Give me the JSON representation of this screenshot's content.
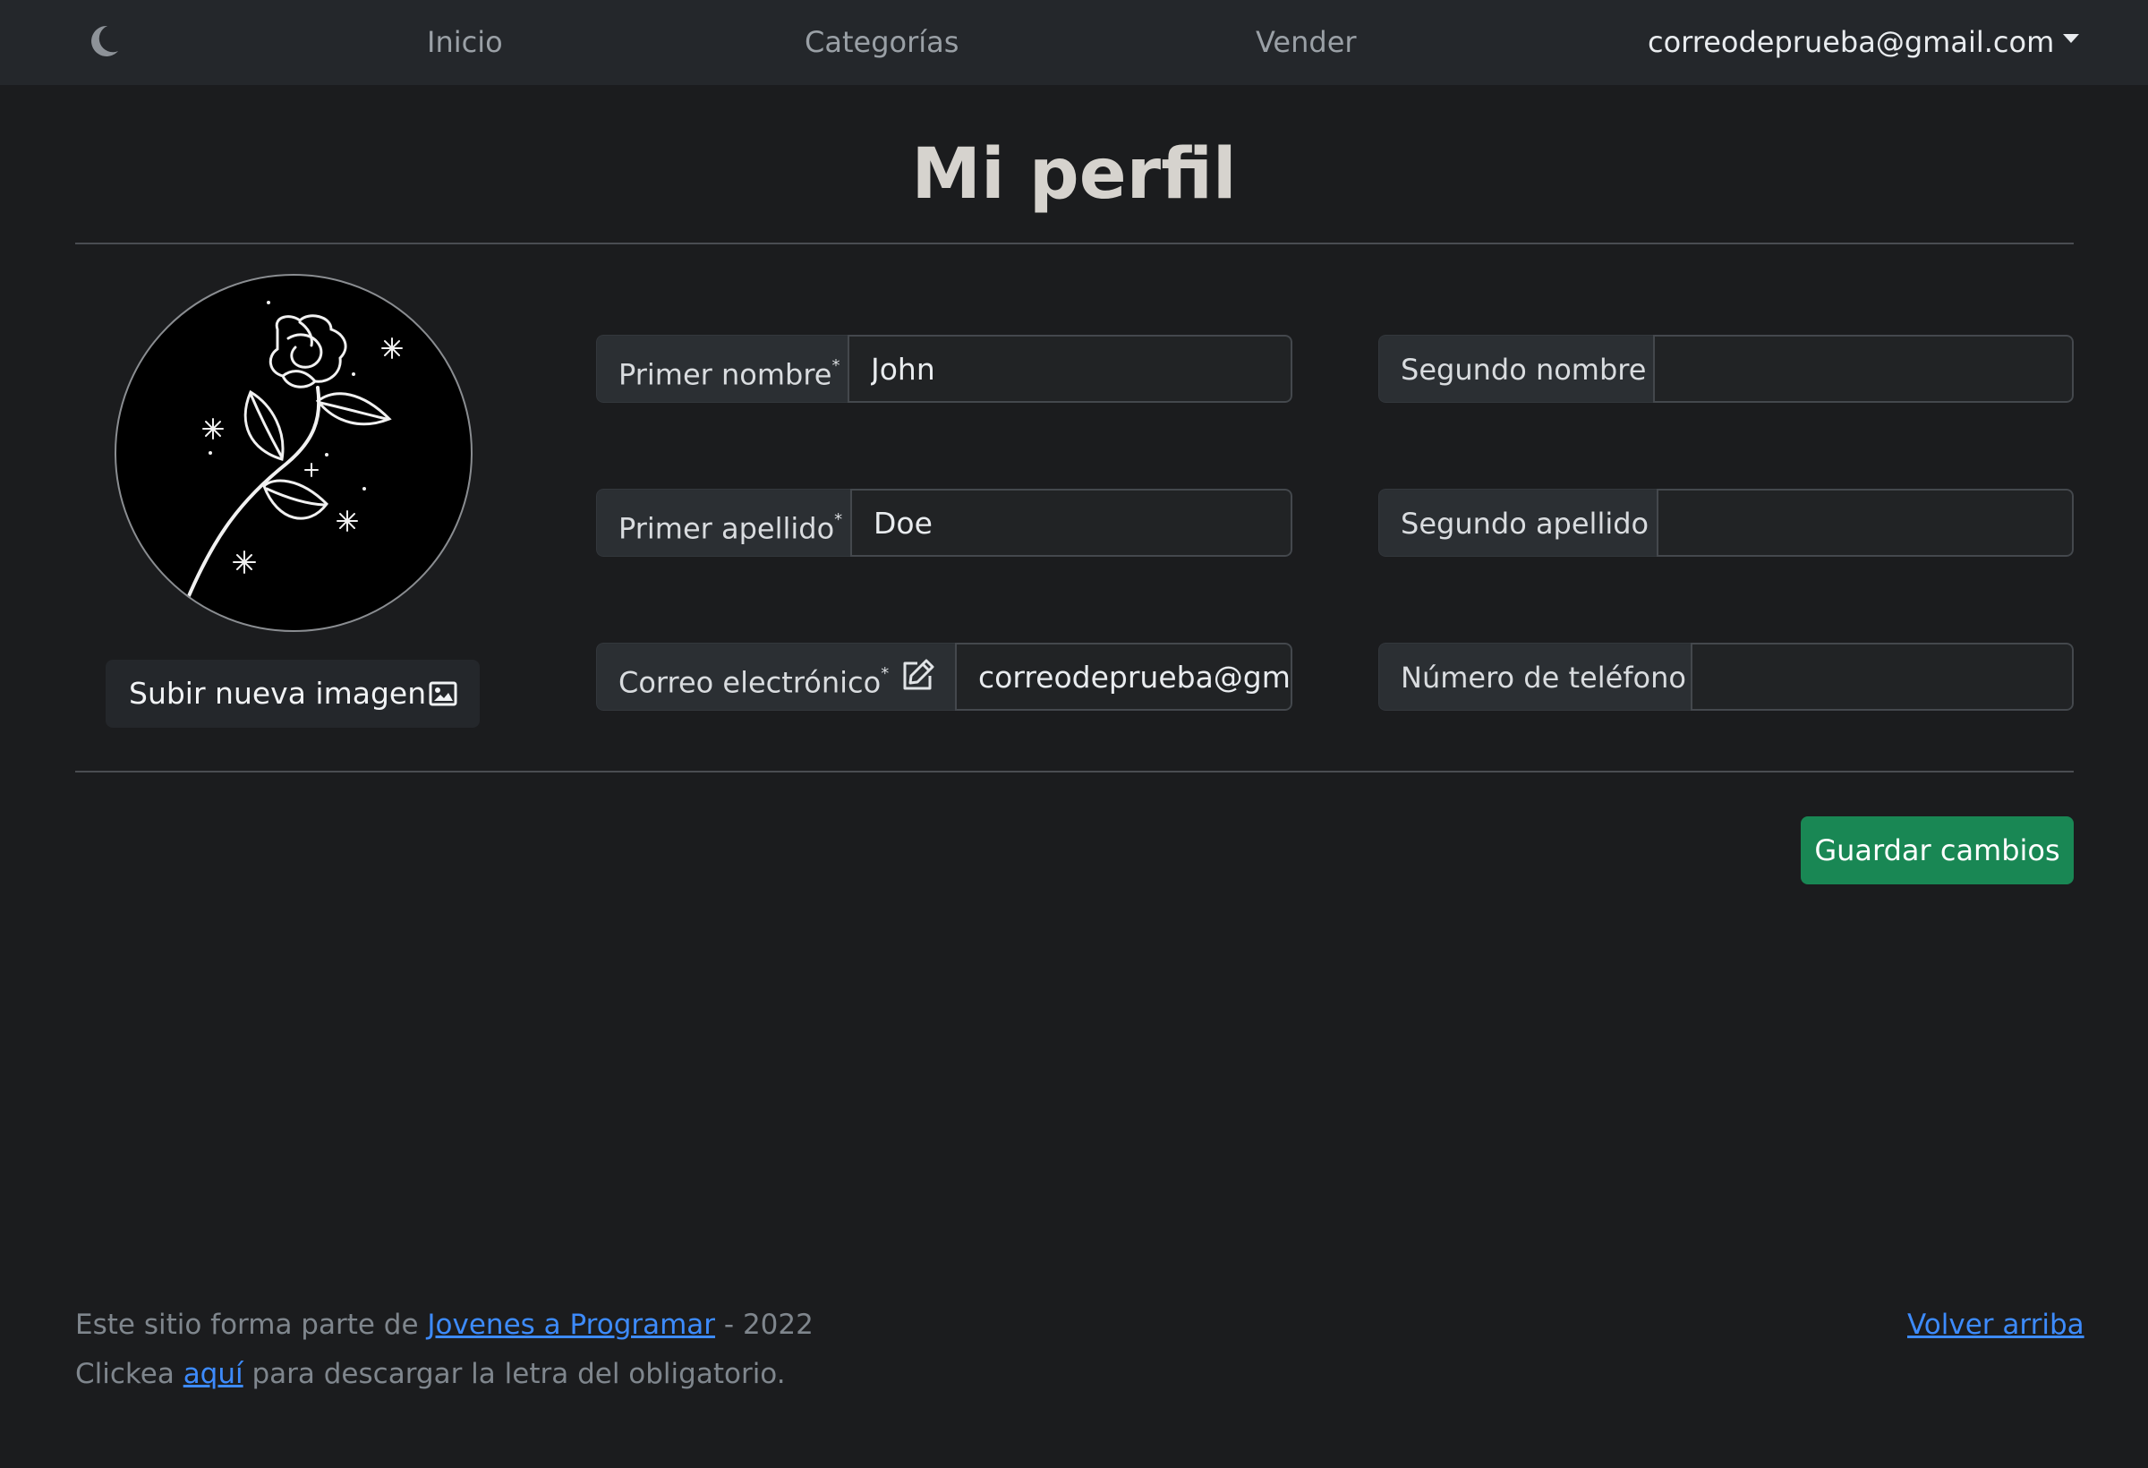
{
  "navbar": {
    "theme_toggle_icon": "moon-icon",
    "links": {
      "inicio": "Inicio",
      "categorias": "Categorías",
      "vender": "Vender"
    },
    "user_email": "correodeprueba@gmail.com"
  },
  "page": {
    "title": "Mi perfil"
  },
  "profile": {
    "upload_button_label": "Subir nueva imagen",
    "upload_icon": "image-icon"
  },
  "form": {
    "primer_nombre": {
      "label": "Primer nombre",
      "required_mark": "*",
      "value": "John"
    },
    "segundo_nombre": {
      "label": "Segundo nombre",
      "value": ""
    },
    "primer_apellido": {
      "label": "Primer apellido",
      "required_mark": "*",
      "value": "Doe"
    },
    "segundo_apellido": {
      "label": "Segundo apellido",
      "value": ""
    },
    "correo": {
      "label": "Correo electrónico",
      "required_mark": "*",
      "value": "correodeprueba@gmail.com",
      "edit_icon": "edit-icon"
    },
    "telefono": {
      "label": "Número de teléfono",
      "value": ""
    }
  },
  "actions": {
    "save_label": "Guardar cambios",
    "save_color": "#198754"
  },
  "footer": {
    "line1_prefix": "Este sitio forma parte de ",
    "line1_link": "Jovenes a Programar",
    "line1_suffix": " - 2022",
    "line2_prefix": "Clickea ",
    "line2_link": "aquí",
    "line2_suffix": " para descargar la letra del obligatorio.",
    "back_to_top": "Volver arriba",
    "link_color": "#3d8bfd"
  }
}
